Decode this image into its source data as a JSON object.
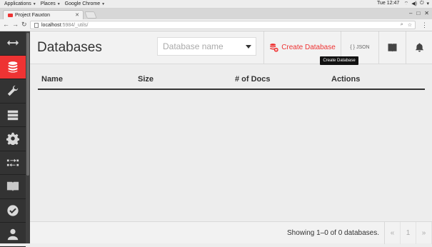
{
  "os_bar": {
    "applications": "Applications",
    "places": "Places",
    "browser": "Google Chrome",
    "clock": "Tue 12:47"
  },
  "browser": {
    "tab_title": "Project Fauxton",
    "url_host": "localhost",
    "url_path": ":5984/_utils/"
  },
  "sidebar": {
    "items": [
      {
        "icon": "arrows-collapse-icon"
      },
      {
        "icon": "database-icon",
        "active": true
      },
      {
        "icon": "wrench-icon"
      },
      {
        "icon": "server-stack-icon"
      },
      {
        "icon": "gear-icon"
      },
      {
        "icon": "replication-icon"
      },
      {
        "icon": "open-book-icon"
      },
      {
        "icon": "checkmark-icon"
      },
      {
        "icon": "user-icon"
      }
    ]
  },
  "header": {
    "title": "Databases",
    "db_select_placeholder": "Database name",
    "create_label": "Create Database",
    "json_label": "{ } JSON",
    "tooltip": "Create Database"
  },
  "table": {
    "columns": [
      "Name",
      "Size",
      "# of Docs",
      "Actions"
    ]
  },
  "footer": {
    "showing": "Showing 1–0 of 0 databases.",
    "prev": "«",
    "page": "1",
    "next": "»"
  },
  "colors": {
    "accent": "#e33333",
    "sidebar_bg": "#333333"
  }
}
